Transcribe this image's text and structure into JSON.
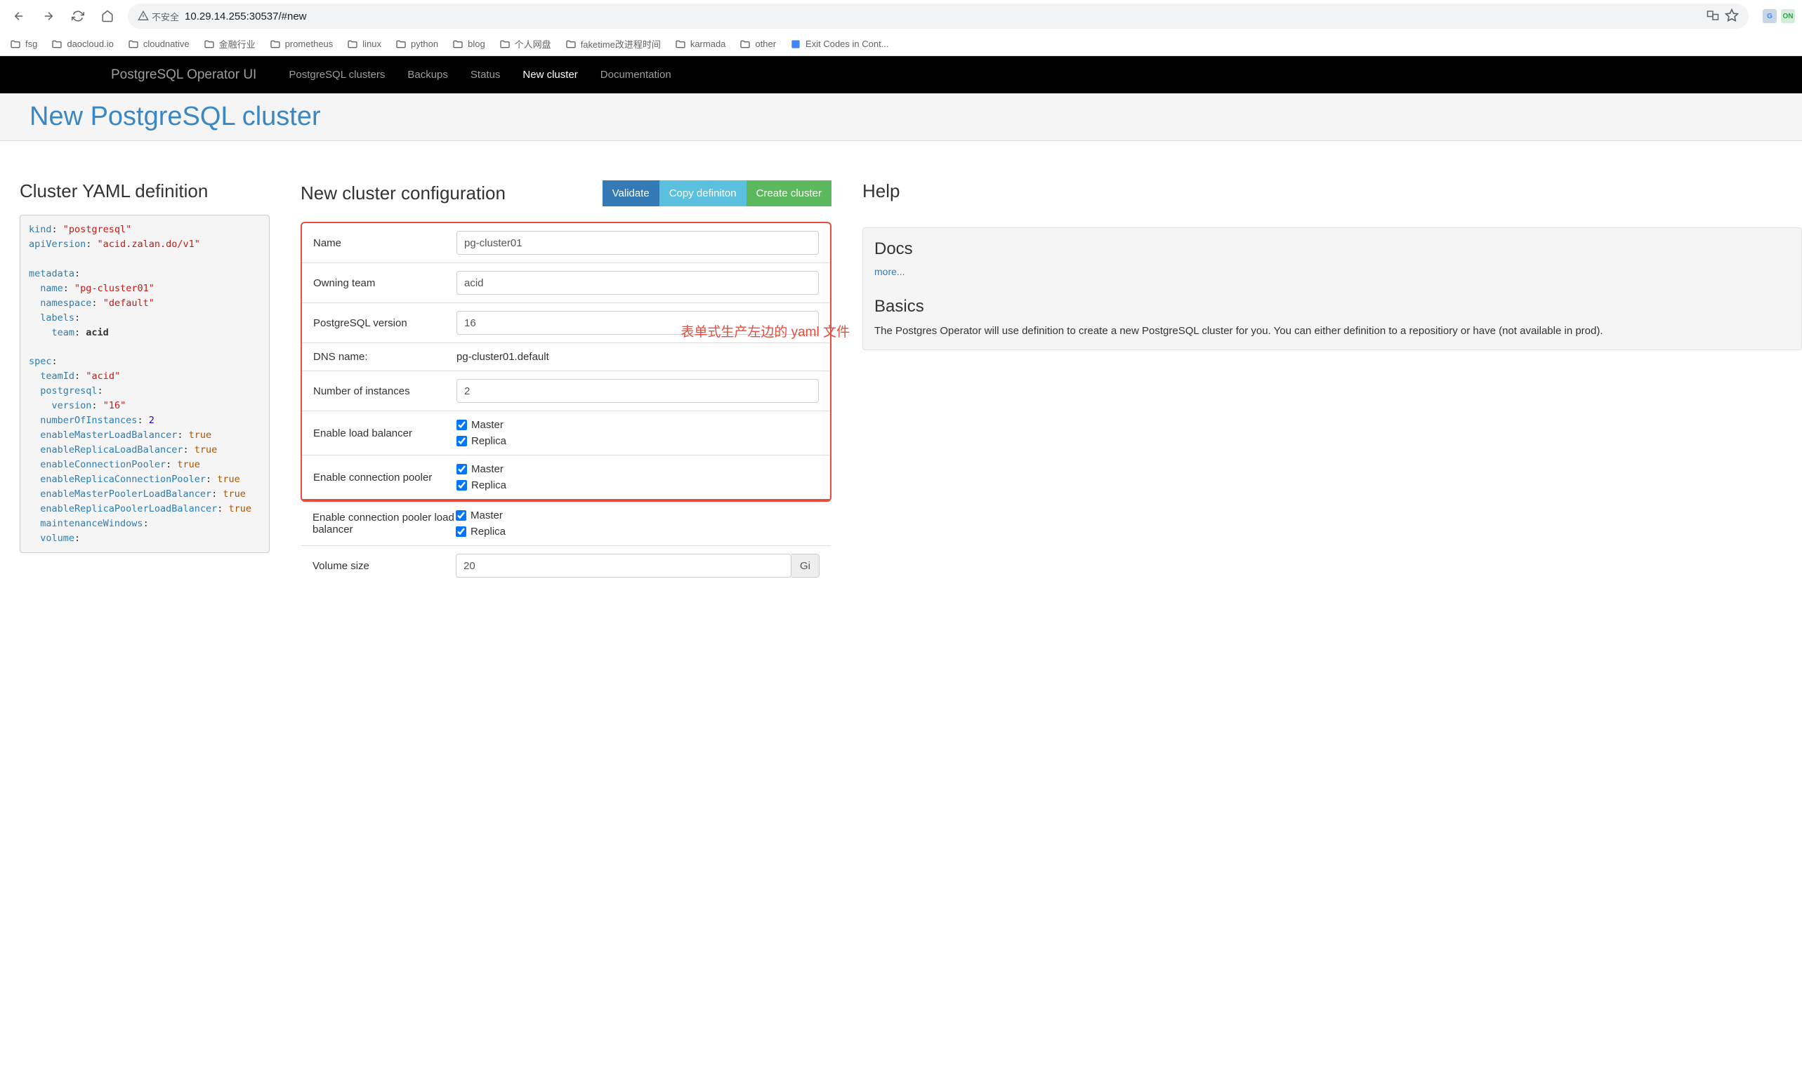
{
  "browser": {
    "security_label": "不安全",
    "url": "10.29.14.255:30537/#new"
  },
  "bookmarks": [
    {
      "label": "fsg"
    },
    {
      "label": "daocloud.io"
    },
    {
      "label": "cloudnative"
    },
    {
      "label": "金融行业"
    },
    {
      "label": "prometheus"
    },
    {
      "label": "linux"
    },
    {
      "label": "python"
    },
    {
      "label": "blog"
    },
    {
      "label": "个人网盘"
    },
    {
      "label": "faketime改进程时间"
    },
    {
      "label": "karmada"
    },
    {
      "label": "other"
    },
    {
      "label": "Exit Codes in Cont...",
      "type": "link"
    }
  ],
  "nav": {
    "brand": "PostgreSQL Operator UI",
    "tabs": [
      {
        "label": "PostgreSQL clusters"
      },
      {
        "label": "Backups"
      },
      {
        "label": "Status"
      },
      {
        "label": "New cluster",
        "active": true
      },
      {
        "label": "Documentation"
      }
    ]
  },
  "page_title": "New PostgreSQL cluster",
  "yaml_section_title": "Cluster YAML definition",
  "yaml": {
    "kind": "\"postgresql\"",
    "apiVersion": "\"acid.zalan.do/v1\"",
    "metadata_name": "\"pg-cluster01\"",
    "metadata_namespace": "\"default\"",
    "metadata_labels_team": "acid",
    "spec_teamId": "\"acid\"",
    "spec_pg_version": "\"16\"",
    "spec_numInstances": "2",
    "spec_enableMasterLB": "true",
    "spec_enableReplicaLB": "true",
    "spec_enableConnPooler": "true",
    "spec_enableReplicaConnPooler": "true",
    "spec_enableMasterPoolerLB": "true",
    "spec_enableReplicaPoolerLB": "true"
  },
  "config": {
    "title": "New cluster configuration",
    "buttons": {
      "validate": "Validate",
      "copy": "Copy definiton",
      "create": "Create cluster"
    },
    "annotation": "表单式生产左边的 yaml 文件",
    "fields": {
      "name_label": "Name",
      "name_value": "pg-cluster01",
      "team_label": "Owning team",
      "team_value": "acid",
      "pgversion_label": "PostgreSQL version",
      "pgversion_value": "16",
      "dns_label": "DNS name:",
      "dns_value": "pg-cluster01.default",
      "instances_label": "Number of instances",
      "instances_value": "2",
      "lb_label": "Enable load balancer",
      "pooler_label": "Enable connection pooler",
      "pooler_lb_label": "Enable connection pooler load balancer",
      "volume_label": "Volume size",
      "volume_value": "20",
      "volume_unit": "Gi",
      "master": "Master",
      "replica": "Replica"
    }
  },
  "help": {
    "title": "Help",
    "docs_title": "Docs",
    "docs_link": "more...",
    "basics_title": "Basics",
    "basics_text": "The Postgres Operator will use definition to create a new PostgreSQL cluster for you. You can either definition to a repositiory or have (not available in prod)."
  }
}
